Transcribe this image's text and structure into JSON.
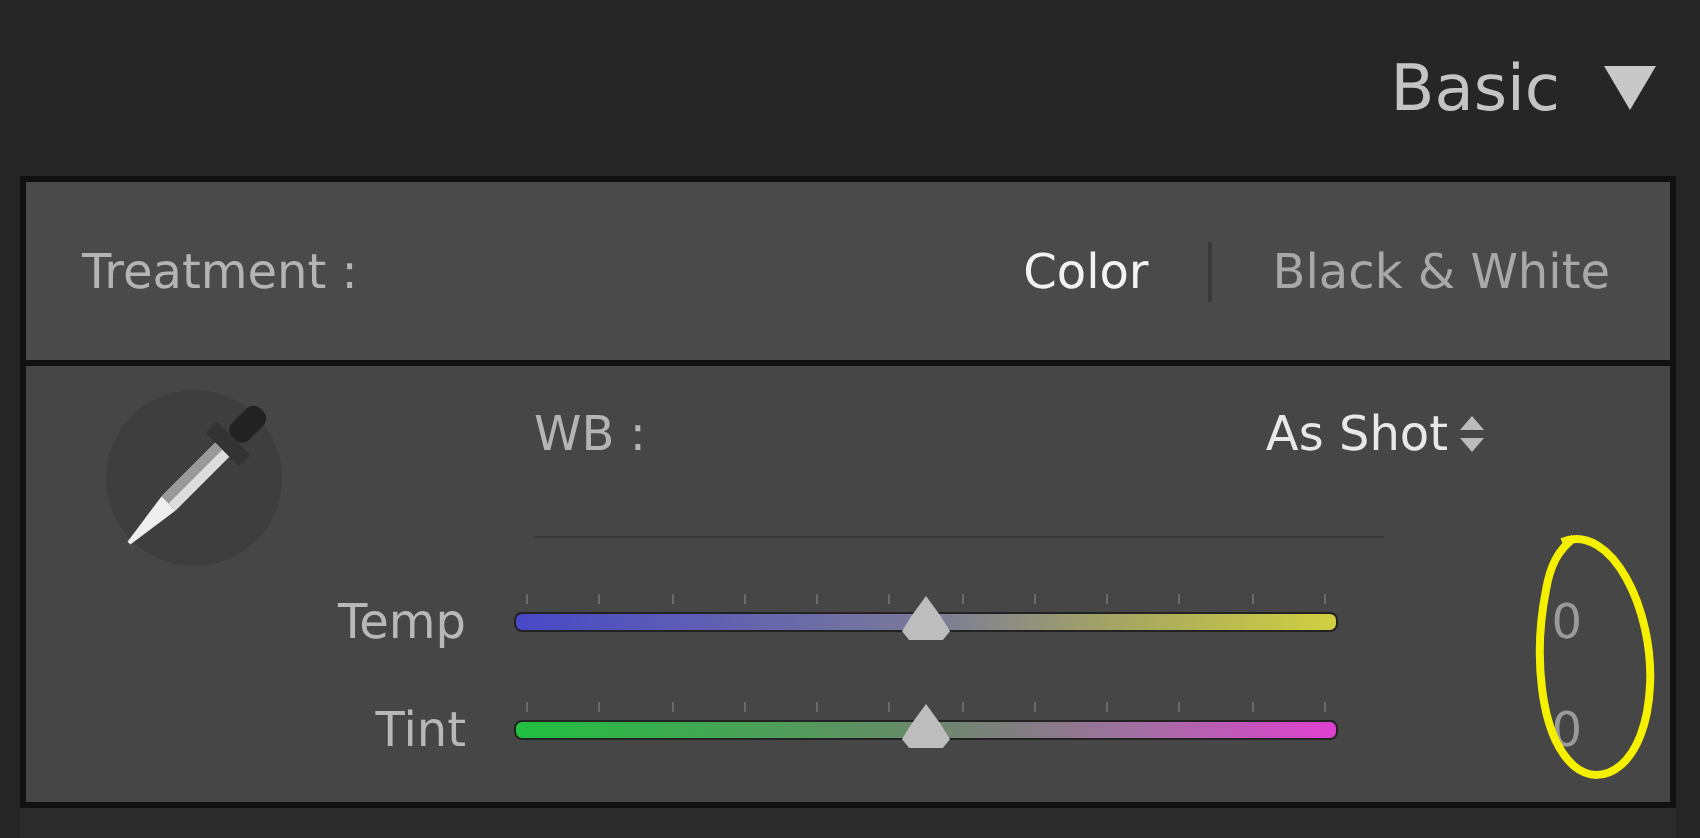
{
  "panel": {
    "title": "Basic",
    "expanded": true
  },
  "treatment": {
    "label": "Treatment :",
    "options": [
      {
        "label": "Color",
        "selected": true
      },
      {
        "label": "Black & White",
        "selected": false
      }
    ]
  },
  "white_balance": {
    "label": "WB :",
    "value": "As Shot"
  },
  "sliders": [
    {
      "kind": "temp",
      "label": "Temp",
      "level": 0.5,
      "reading": "0"
    },
    {
      "kind": "tint",
      "label": "Tint",
      "level": 0.5,
      "reading": "0"
    }
  ]
}
